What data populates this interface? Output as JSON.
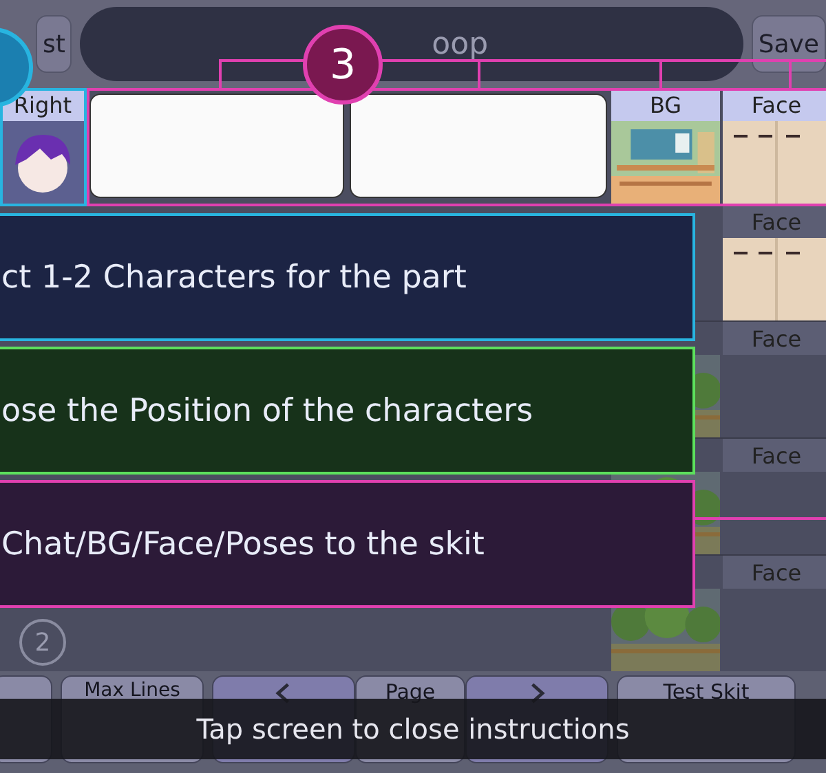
{
  "top_bar": {
    "left_button": "st",
    "title": "oop",
    "save_button": "Save"
  },
  "callouts": [
    {
      "color": "#1b7fb0"
    },
    {
      "number": "3",
      "color": "#7a1850"
    }
  ],
  "header_row": {
    "position": "Right",
    "bg_label": "BG",
    "face_label": "Face"
  },
  "rows": [
    {
      "face_label": "Face",
      "kind": "empty"
    },
    {
      "face_label": "Face",
      "kind": "scene"
    },
    {
      "face_label": "Face",
      "kind": "scene"
    },
    {
      "face_label": "Face",
      "kind": "scene",
      "slot_number": "2"
    }
  ],
  "instructions": [
    {
      "text": "ct 1-2 Characters for the part",
      "color": "#28b4e0"
    },
    {
      "text": "ose the Position of the characters",
      "color": "#5ce05c"
    },
    {
      "text": "Chat/BG/Face/Poses to the skit",
      "color": "#e040b0"
    }
  ],
  "bottom_bar": {
    "max_lines_label": "Max Lines",
    "page_label": "Page",
    "test_label": "Test Skit"
  },
  "toast": "Tap screen to close instructions"
}
